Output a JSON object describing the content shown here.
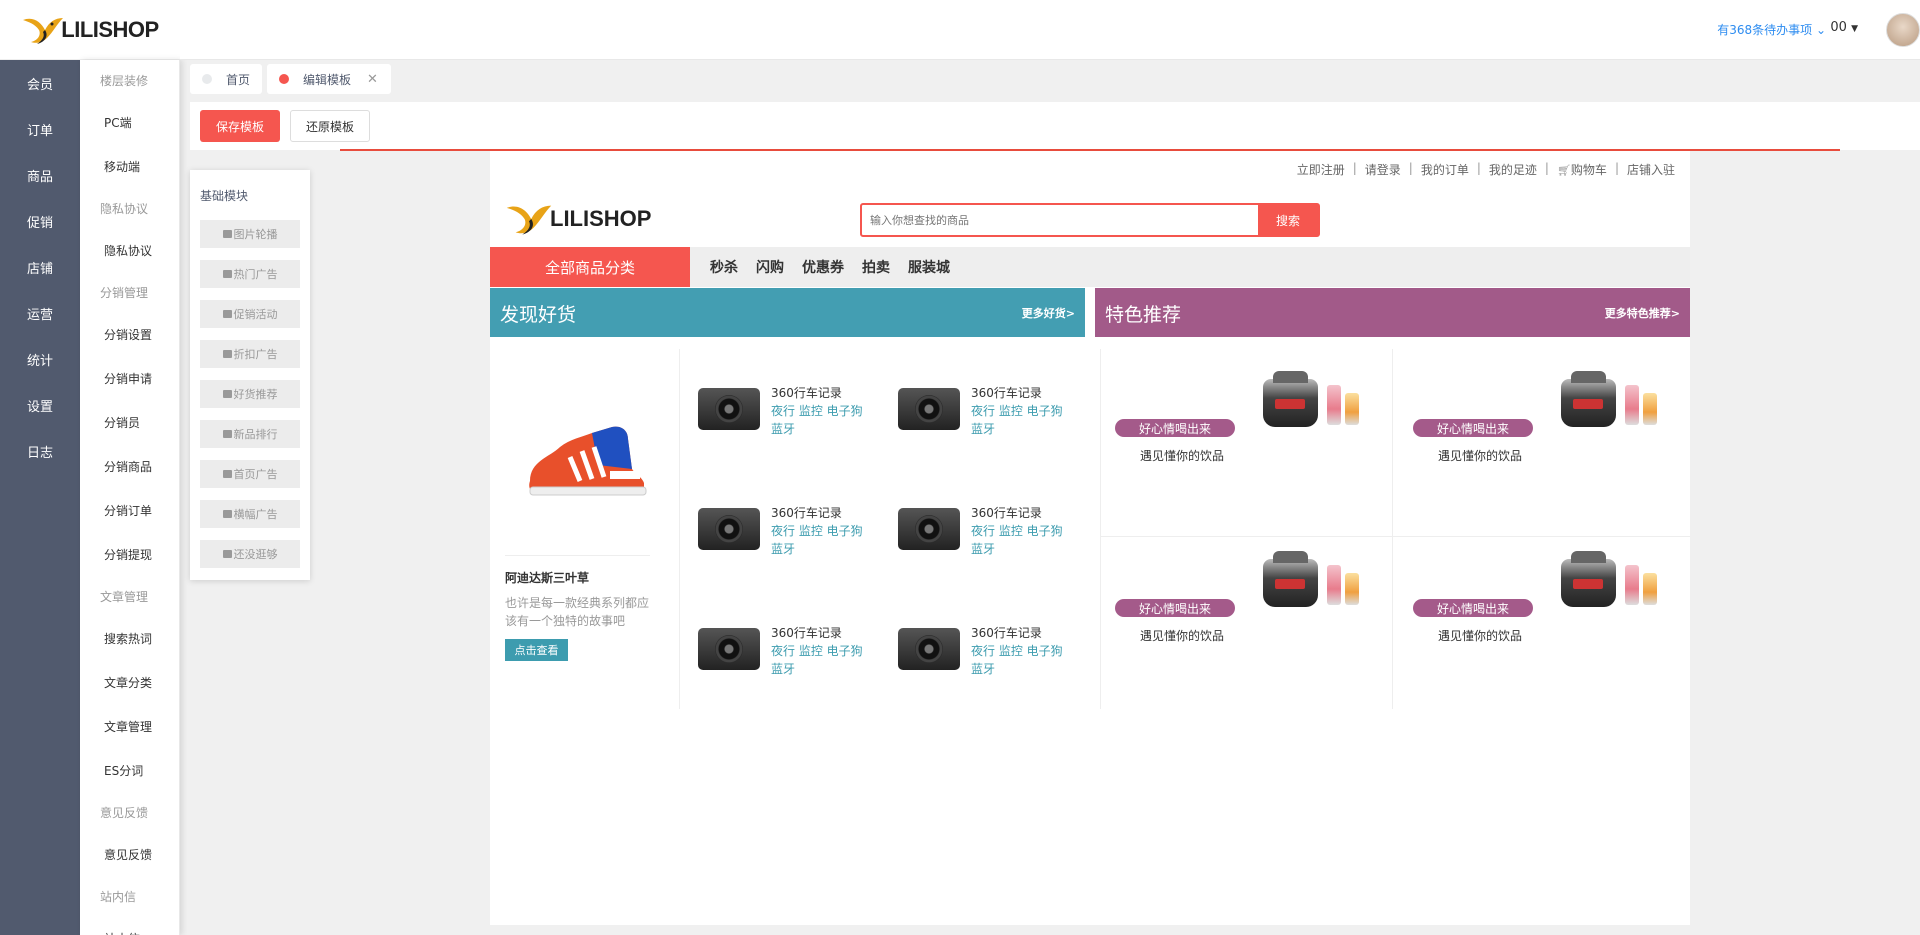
{
  "app": {
    "logo_text": "LILISHOP"
  },
  "rail": [
    "会员",
    "订单",
    "商品",
    "促销",
    "店铺",
    "运营",
    "统计",
    "设置",
    "日志"
  ],
  "submenu": [
    {
      "type": "group",
      "label": "楼层装修"
    },
    {
      "type": "item",
      "label": "PC端"
    },
    {
      "type": "item",
      "label": "移动端"
    },
    {
      "type": "group",
      "label": "隐私协议"
    },
    {
      "type": "item",
      "label": "隐私协议"
    },
    {
      "type": "group",
      "label": "分销管理"
    },
    {
      "type": "item",
      "label": "分销设置"
    },
    {
      "type": "item",
      "label": "分销申请"
    },
    {
      "type": "item",
      "label": "分销员"
    },
    {
      "type": "item",
      "label": "分销商品"
    },
    {
      "type": "item",
      "label": "分销订单"
    },
    {
      "type": "item",
      "label": "分销提现"
    },
    {
      "type": "group",
      "label": "文章管理"
    },
    {
      "type": "item",
      "label": "搜索热词"
    },
    {
      "type": "item",
      "label": "文章分类"
    },
    {
      "type": "item",
      "label": "文章管理"
    },
    {
      "type": "item",
      "label": "ES分词"
    },
    {
      "type": "group",
      "label": "意见反馈"
    },
    {
      "type": "item",
      "label": "意见反馈"
    },
    {
      "type": "group",
      "label": "站内信"
    },
    {
      "type": "item",
      "label": "站内信"
    }
  ],
  "header": {
    "todo": "有368条待办事项",
    "user": "00"
  },
  "tabs": [
    {
      "label": "首页",
      "dot_color": "#e8eaec"
    },
    {
      "label": "编辑模板",
      "dot_color": "#f5564f"
    }
  ],
  "toolbar": {
    "save": "保存模板",
    "restore": "还原模板"
  },
  "modules": {
    "title": "基础模块",
    "items": [
      "图片轮播",
      "热门广告",
      "促销活动",
      "折扣广告",
      "好货推荐",
      "新品排行",
      "首页广告",
      "横幅广告",
      "还没逛够"
    ]
  },
  "preview": {
    "top_links": [
      "立即注册",
      "请登录",
      "我的订单",
      "我的足迹",
      "购物车",
      "店铺入驻"
    ],
    "search_placeholder": "输入你想查找的商品",
    "search_button": "搜索",
    "all_categories": "全部商品分类",
    "nav_links": [
      "秒杀",
      "闪购",
      "优惠券",
      "拍卖",
      "服装城"
    ],
    "discover": {
      "title": "发现好货",
      "more": "更多好货>",
      "color": "#439eb2"
    },
    "featured": {
      "title": "特色推荐",
      "more": "更多特色推荐>",
      "color": "#a25a89"
    },
    "hero_product": {
      "name": "阿迪达斯三叶草",
      "desc": "也许是每一款经典系列都应该有一个独特的故事吧",
      "button": "点击查看"
    },
    "products": [
      {
        "title": "360行车记录",
        "tags": "夜行 监控 电子狗 蓝牙"
      },
      {
        "title": "360行车记录",
        "tags": "夜行 监控 电子狗 蓝牙"
      },
      {
        "title": "360行车记录",
        "tags": "夜行 监控 电子狗 蓝牙"
      },
      {
        "title": "360行车记录",
        "tags": "夜行 监控 电子狗 蓝牙"
      },
      {
        "title": "360行车记录",
        "tags": "夜行 监控 电子狗 蓝牙"
      },
      {
        "title": "360行车记录",
        "tags": "夜行 监控 电子狗 蓝牙"
      }
    ],
    "features": [
      {
        "badge": "好心情喝出来",
        "sub": "遇见懂你的饮品"
      },
      {
        "badge": "好心情喝出来",
        "sub": "遇见懂你的饮品"
      },
      {
        "badge": "好心情喝出来",
        "sub": "遇见懂你的饮品"
      },
      {
        "badge": "好心情喝出来",
        "sub": "遇见懂你的饮品"
      }
    ]
  }
}
